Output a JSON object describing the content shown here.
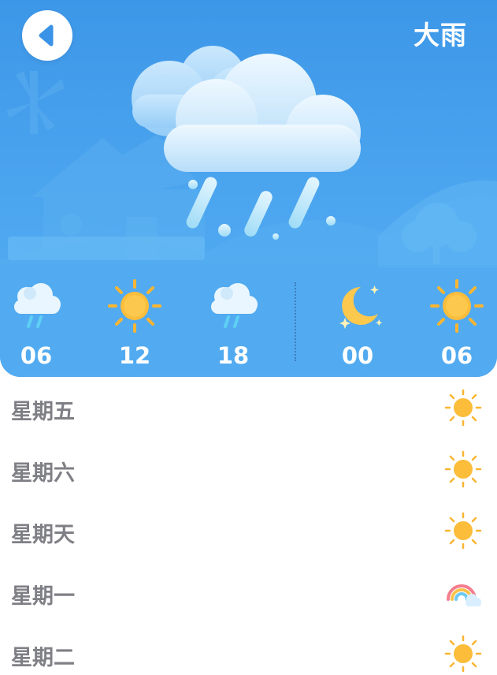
{
  "header": {
    "condition": "大雨",
    "back_icon": "back-arrow-icon"
  },
  "hero": {
    "icon": "heavy-rain-cloud-icon",
    "background": "#4aa3ee"
  },
  "hourly": [
    {
      "time": "06",
      "icon": "rain-cloud-icon"
    },
    {
      "time": "12",
      "icon": "sun-icon"
    },
    {
      "time": "18",
      "icon": "rain-cloud-icon"
    },
    {
      "time": "00",
      "icon": "moon-icon"
    },
    {
      "time": "06",
      "icon": "sun-icon"
    }
  ],
  "daily": [
    {
      "day": "星期五",
      "icon": "sun-icon"
    },
    {
      "day": "星期六",
      "icon": "sun-icon"
    },
    {
      "day": "星期天",
      "icon": "sun-icon"
    },
    {
      "day": "星期一",
      "icon": "rainbow-icon"
    },
    {
      "day": "星期二",
      "icon": "sun-icon"
    }
  ],
  "colors": {
    "sky": "#4aa3ee",
    "sun": "#f9b532",
    "day_text": "#7f7f86"
  }
}
